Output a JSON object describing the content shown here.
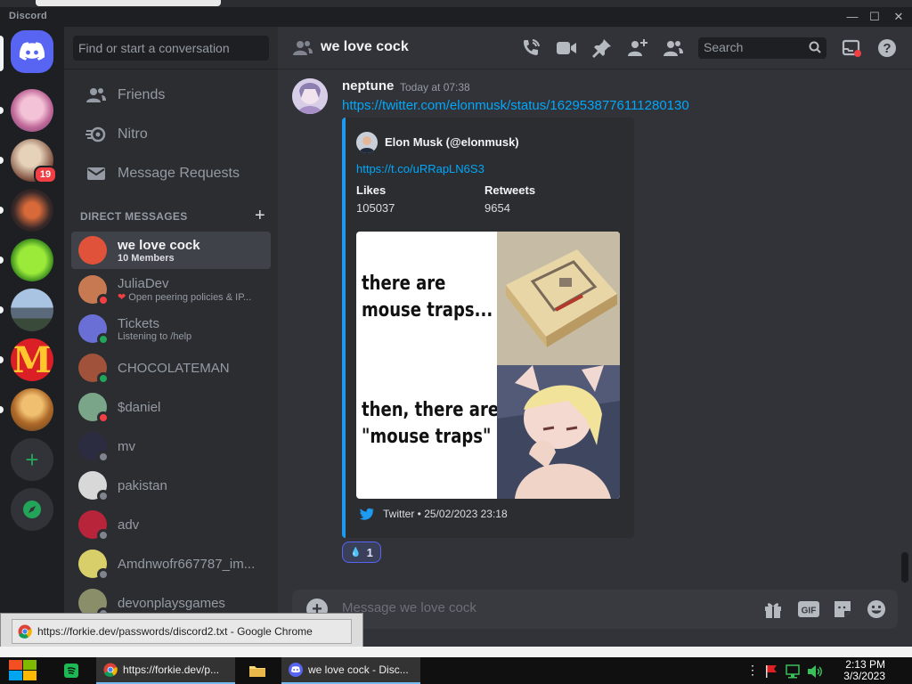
{
  "window": {
    "title": "Discord"
  },
  "sidebar": {
    "search_placeholder": "Find or start a conversation",
    "nav": [
      {
        "label": "Friends",
        "icon": "friends-icon"
      },
      {
        "label": "Nitro",
        "icon": "nitro-icon"
      },
      {
        "label": "Message Requests",
        "icon": "envelope-icon"
      }
    ],
    "dm_header": "DIRECT MESSAGES",
    "dms": [
      {
        "name": "we love cock",
        "sub": "10 Members",
        "status": "group",
        "color": "#e0533a"
      },
      {
        "name": "JuliaDev",
        "sub": "Open peering policies & IP...",
        "status": "dnd",
        "color": "#c77a52"
      },
      {
        "name": "Tickets",
        "sub": "Listening to /help",
        "status": "online",
        "color": "#6a6fd6"
      },
      {
        "name": "CHOCOLATEMAN",
        "sub": "",
        "status": "online",
        "color": "#a0523b"
      },
      {
        "name": "$daniel",
        "sub": "",
        "status": "dnd",
        "color": "#7aa588"
      },
      {
        "name": "mv",
        "sub": "",
        "status": "offline",
        "color": "#2c2c40"
      },
      {
        "name": "pakistan",
        "sub": "",
        "status": "offline",
        "color": "#d8d8d8"
      },
      {
        "name": "adv",
        "sub": "",
        "status": "offline",
        "color": "#b8243a"
      },
      {
        "name": "Amdnwofr667787_im...",
        "sub": "",
        "status": "offline",
        "color": "#d9cf6a"
      },
      {
        "name": "devonplaysgames",
        "sub": "",
        "status": "offline",
        "color": "#8a8f6a"
      }
    ]
  },
  "rail": {
    "badge_count": "19"
  },
  "channel": {
    "title": "we love cock",
    "search_placeholder": "Search"
  },
  "message": {
    "author": "neptune",
    "time": "Today at 07:38",
    "link": "https://twitter.com/elonmusk/status/1629538776111280130"
  },
  "embed": {
    "author": "Elon Musk (@elonmusk)",
    "link": "https://t.co/uRRapLN6S3",
    "likes_label": "Likes",
    "likes_value": "105037",
    "retweets_label": "Retweets",
    "retweets_value": "9654",
    "image_text_top": "there are\nmouse traps...",
    "image_text_bottom": "then, there are\n\"mouse traps\"",
    "footer": "Twitter • 25/02/2023 23:18",
    "accent": "#1d9bf0"
  },
  "reaction": {
    "emoji": "💧",
    "count": "1"
  },
  "composer": {
    "placeholder": "Message we love cock"
  },
  "tooltip": {
    "text": "https://forkie.dev/passwords/discord2.txt - Google Chrome"
  },
  "taskbar": {
    "chrome_label": "https://forkie.dev/p...",
    "discord_label": "we love cock - Disc...",
    "time": "2:13 PM",
    "date": "3/3/2023"
  }
}
